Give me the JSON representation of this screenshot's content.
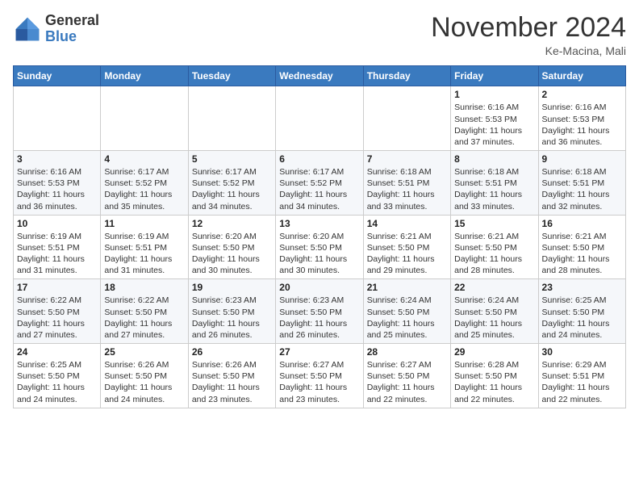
{
  "header": {
    "logo_general": "General",
    "logo_blue": "Blue",
    "month_title": "November 2024",
    "location": "Ke-Macina, Mali"
  },
  "calendar": {
    "days_of_week": [
      "Sunday",
      "Monday",
      "Tuesday",
      "Wednesday",
      "Thursday",
      "Friday",
      "Saturday"
    ],
    "weeks": [
      [
        {
          "day": "",
          "info": ""
        },
        {
          "day": "",
          "info": ""
        },
        {
          "day": "",
          "info": ""
        },
        {
          "day": "",
          "info": ""
        },
        {
          "day": "",
          "info": ""
        },
        {
          "day": "1",
          "info": "Sunrise: 6:16 AM\nSunset: 5:53 PM\nDaylight: 11 hours\nand 37 minutes."
        },
        {
          "day": "2",
          "info": "Sunrise: 6:16 AM\nSunset: 5:53 PM\nDaylight: 11 hours\nand 36 minutes."
        }
      ],
      [
        {
          "day": "3",
          "info": "Sunrise: 6:16 AM\nSunset: 5:53 PM\nDaylight: 11 hours\nand 36 minutes."
        },
        {
          "day": "4",
          "info": "Sunrise: 6:17 AM\nSunset: 5:52 PM\nDaylight: 11 hours\nand 35 minutes."
        },
        {
          "day": "5",
          "info": "Sunrise: 6:17 AM\nSunset: 5:52 PM\nDaylight: 11 hours\nand 34 minutes."
        },
        {
          "day": "6",
          "info": "Sunrise: 6:17 AM\nSunset: 5:52 PM\nDaylight: 11 hours\nand 34 minutes."
        },
        {
          "day": "7",
          "info": "Sunrise: 6:18 AM\nSunset: 5:51 PM\nDaylight: 11 hours\nand 33 minutes."
        },
        {
          "day": "8",
          "info": "Sunrise: 6:18 AM\nSunset: 5:51 PM\nDaylight: 11 hours\nand 33 minutes."
        },
        {
          "day": "9",
          "info": "Sunrise: 6:18 AM\nSunset: 5:51 PM\nDaylight: 11 hours\nand 32 minutes."
        }
      ],
      [
        {
          "day": "10",
          "info": "Sunrise: 6:19 AM\nSunset: 5:51 PM\nDaylight: 11 hours\nand 31 minutes."
        },
        {
          "day": "11",
          "info": "Sunrise: 6:19 AM\nSunset: 5:51 PM\nDaylight: 11 hours\nand 31 minutes."
        },
        {
          "day": "12",
          "info": "Sunrise: 6:20 AM\nSunset: 5:50 PM\nDaylight: 11 hours\nand 30 minutes."
        },
        {
          "day": "13",
          "info": "Sunrise: 6:20 AM\nSunset: 5:50 PM\nDaylight: 11 hours\nand 30 minutes."
        },
        {
          "day": "14",
          "info": "Sunrise: 6:21 AM\nSunset: 5:50 PM\nDaylight: 11 hours\nand 29 minutes."
        },
        {
          "day": "15",
          "info": "Sunrise: 6:21 AM\nSunset: 5:50 PM\nDaylight: 11 hours\nand 28 minutes."
        },
        {
          "day": "16",
          "info": "Sunrise: 6:21 AM\nSunset: 5:50 PM\nDaylight: 11 hours\nand 28 minutes."
        }
      ],
      [
        {
          "day": "17",
          "info": "Sunrise: 6:22 AM\nSunset: 5:50 PM\nDaylight: 11 hours\nand 27 minutes."
        },
        {
          "day": "18",
          "info": "Sunrise: 6:22 AM\nSunset: 5:50 PM\nDaylight: 11 hours\nand 27 minutes."
        },
        {
          "day": "19",
          "info": "Sunrise: 6:23 AM\nSunset: 5:50 PM\nDaylight: 11 hours\nand 26 minutes."
        },
        {
          "day": "20",
          "info": "Sunrise: 6:23 AM\nSunset: 5:50 PM\nDaylight: 11 hours\nand 26 minutes."
        },
        {
          "day": "21",
          "info": "Sunrise: 6:24 AM\nSunset: 5:50 PM\nDaylight: 11 hours\nand 25 minutes."
        },
        {
          "day": "22",
          "info": "Sunrise: 6:24 AM\nSunset: 5:50 PM\nDaylight: 11 hours\nand 25 minutes."
        },
        {
          "day": "23",
          "info": "Sunrise: 6:25 AM\nSunset: 5:50 PM\nDaylight: 11 hours\nand 24 minutes."
        }
      ],
      [
        {
          "day": "24",
          "info": "Sunrise: 6:25 AM\nSunset: 5:50 PM\nDaylight: 11 hours\nand 24 minutes."
        },
        {
          "day": "25",
          "info": "Sunrise: 6:26 AM\nSunset: 5:50 PM\nDaylight: 11 hours\nand 24 minutes."
        },
        {
          "day": "26",
          "info": "Sunrise: 6:26 AM\nSunset: 5:50 PM\nDaylight: 11 hours\nand 23 minutes."
        },
        {
          "day": "27",
          "info": "Sunrise: 6:27 AM\nSunset: 5:50 PM\nDaylight: 11 hours\nand 23 minutes."
        },
        {
          "day": "28",
          "info": "Sunrise: 6:27 AM\nSunset: 5:50 PM\nDaylight: 11 hours\nand 22 minutes."
        },
        {
          "day": "29",
          "info": "Sunrise: 6:28 AM\nSunset: 5:50 PM\nDaylight: 11 hours\nand 22 minutes."
        },
        {
          "day": "30",
          "info": "Sunrise: 6:29 AM\nSunset: 5:51 PM\nDaylight: 11 hours\nand 22 minutes."
        }
      ]
    ]
  }
}
